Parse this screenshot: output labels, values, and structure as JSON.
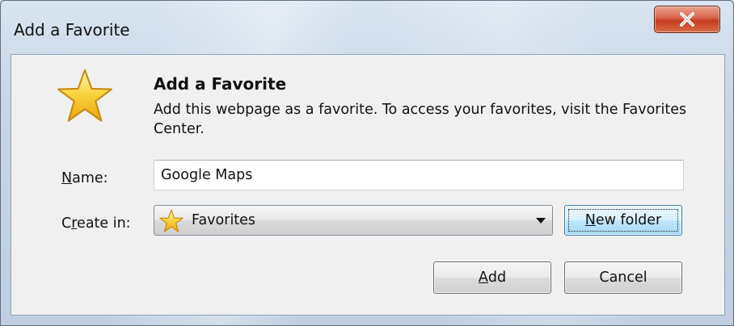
{
  "window": {
    "title": "Add a Favorite",
    "close_icon": "close-x-icon"
  },
  "header": {
    "icon": "favorite-star-icon",
    "title": "Add a Favorite",
    "description": "Add this webpage as a favorite. To access your favorites, visit the Favorites Center."
  },
  "form": {
    "name_label_accesskey": "N",
    "name_label_rest": "ame:",
    "name_value": "Google Maps",
    "create_label_pre": "C",
    "create_label_accesskey": "r",
    "create_label_rest": "eate in:",
    "create_in_value": "Favorites",
    "create_in_icon": "favorites-folder-star-icon"
  },
  "buttons": {
    "new_folder_accesskey": "N",
    "new_folder_rest": "ew folder",
    "add_accesskey": "A",
    "add_rest": "dd",
    "cancel": "Cancel"
  },
  "colors": {
    "close_button": "#c23b1f",
    "star": "#f7c623",
    "focus_button": "#bee6fd"
  }
}
